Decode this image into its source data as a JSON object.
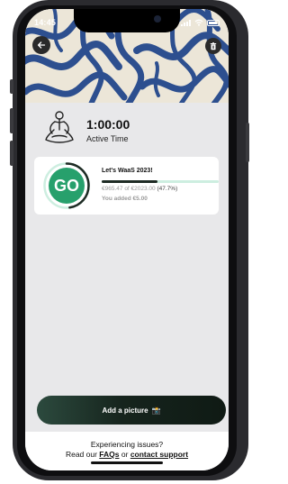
{
  "status_bar": {
    "time": "14:45"
  },
  "session": {
    "active_time": "1:00:00",
    "active_label": "Active Time"
  },
  "campaign": {
    "badge": "GO",
    "title": "Let's WaaS 2023!",
    "amount_raised": "€965.47",
    "of_word": "of",
    "goal": "€2023.00",
    "percent": "(47.7%)",
    "progress_fraction": 0.477,
    "you_added": "You added €5.00"
  },
  "actions": {
    "add_picture": "Add a picture",
    "add_picture_emoji": "📸"
  },
  "footer": {
    "line1": "Experiencing issues?",
    "prefix": "Read our",
    "faqs_link": "FAQs",
    "or_word": "or",
    "support_link": "contact support"
  },
  "icons": [
    "back-arrow-icon",
    "trash-icon",
    "meditation-icon",
    "signal-icon",
    "wifi-icon",
    "battery-icon"
  ],
  "colors": {
    "accent_green": "#27a06c",
    "button_dark": "#0f1a14",
    "progress_track": "#cdeee0"
  }
}
